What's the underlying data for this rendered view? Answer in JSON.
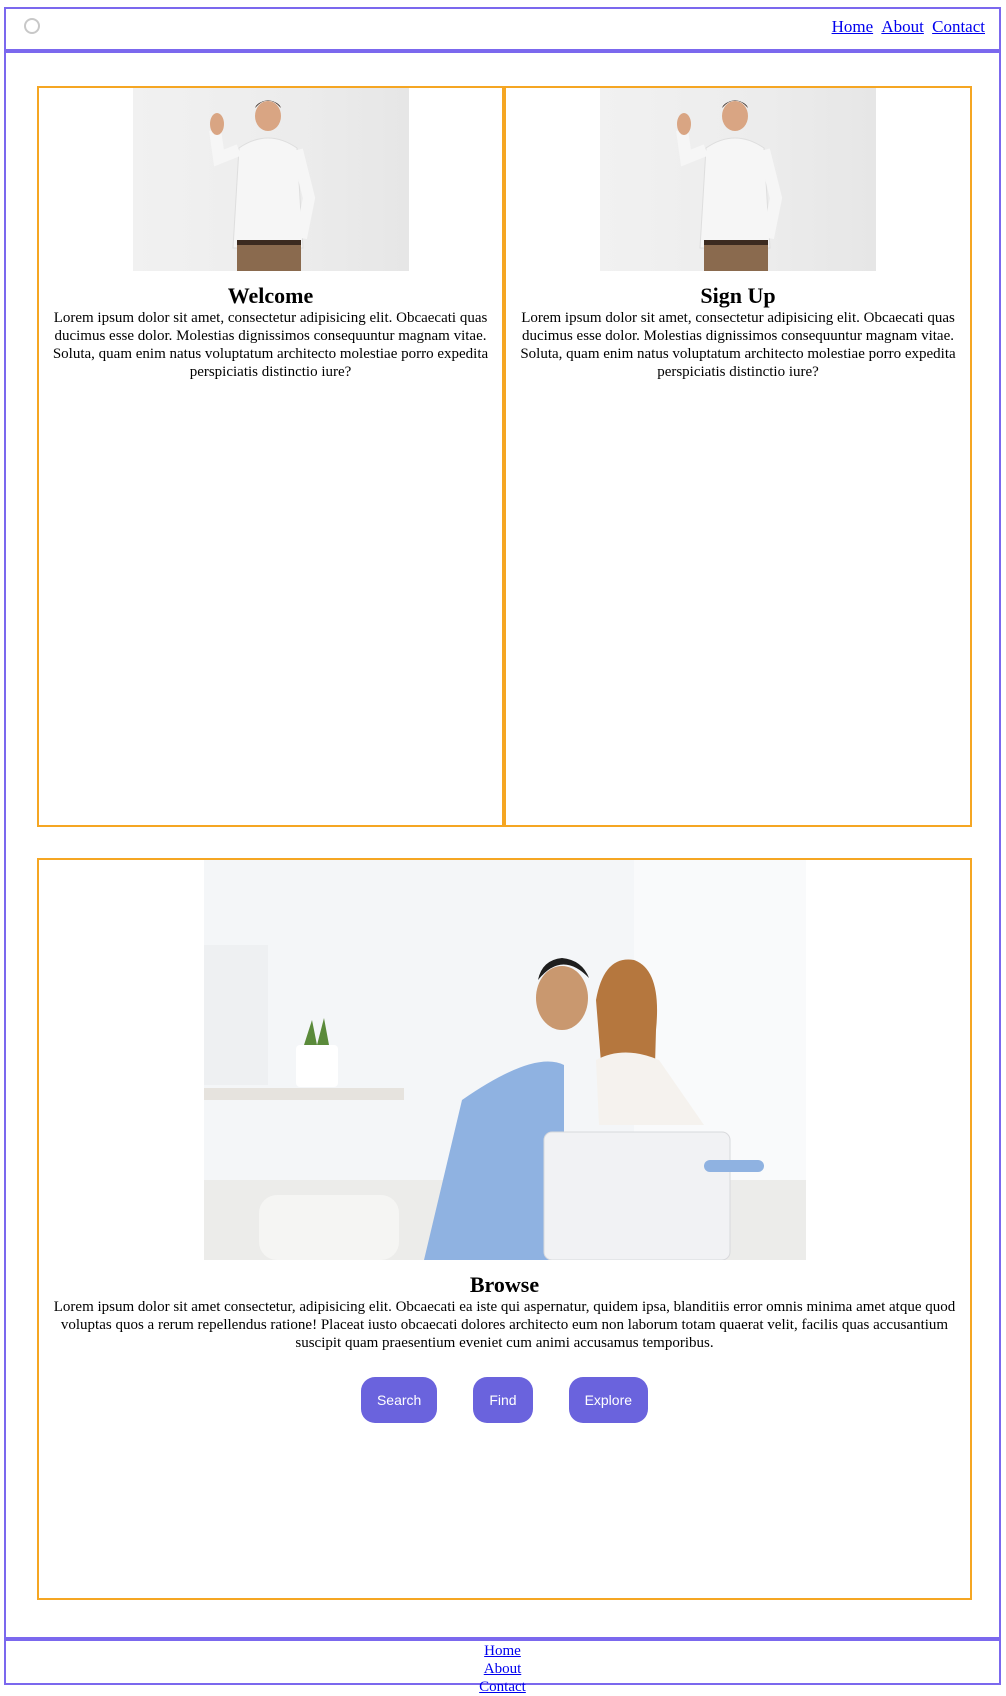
{
  "header": {
    "logo_icon": "circle-logo-icon",
    "nav": {
      "home": "Home",
      "about": "About",
      "contact": "Contact"
    }
  },
  "cards": {
    "welcome": {
      "title": "Welcome",
      "text": "Lorem ipsum dolor sit amet, consectetur adipisicing elit. Obcaecati quas ducimus esse dolor. Molestias dignissimos consequuntur magnam vitae. Soluta, quam enim natus voluptatum architecto molestiae porro expedita perspiciatis distinctio iure?"
    },
    "signup": {
      "title": "Sign Up",
      "text": "Lorem ipsum dolor sit amet, consectetur adipisicing elit. Obcaecati quas ducimus esse dolor. Molestias dignissimos consequuntur magnam vitae. Soluta, quam enim natus voluptatum architecto molestiae porro expedita perspiciatis distinctio iure?"
    },
    "browse": {
      "title": "Browse",
      "text": "Lorem ipsum dolor sit amet consectetur, adipisicing elit. Obcaecati ea iste qui aspernatur, quidem ipsa, blanditiis error omnis minima amet atque quod voluptas quos a rerum repellendus ratione! Placeat iusto obcaecati dolores architecto eum non laborum totam quaerat velit, facilis quas accusantium suscipit quam praesentium eveniet cum animi accusamus temporibus.",
      "buttons": {
        "search": "Search",
        "find": "Find",
        "explore": "Explore"
      }
    }
  },
  "footer": {
    "nav": {
      "home": "Home",
      "about": "About",
      "contact": "Contact"
    }
  },
  "colors": {
    "frame_border": "#7b68ee",
    "card_border": "#f5a623",
    "button_bg": "#6a63dd",
    "link": "#0000ee"
  }
}
